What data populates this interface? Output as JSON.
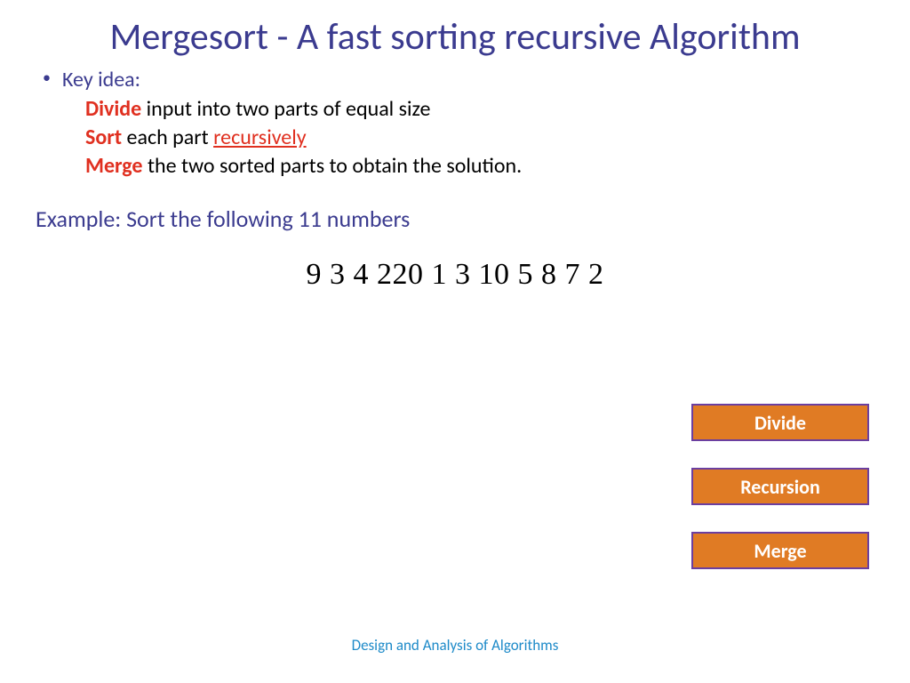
{
  "title": "Mergesort - A fast sorting recursive Algorithm",
  "bullets": {
    "lead": "Key idea:",
    "line1": {
      "kw": "Divide",
      "rest": " input into two parts of equal size"
    },
    "line2": {
      "kw": "Sort",
      "mid": " each part ",
      "link": "recursively"
    },
    "line3": {
      "kw": "Merge",
      "rest": " the two sorted parts to obtain the solution."
    }
  },
  "example_head": "Example: Sort the following 11 numbers",
  "numbers": "9 3 4 220 1 3 10 5 8 7 2",
  "buttons": {
    "divide": "Divide",
    "recursion": "Recursion",
    "merge": "Merge"
  },
  "footer": "Design and Analysis of Algorithms"
}
